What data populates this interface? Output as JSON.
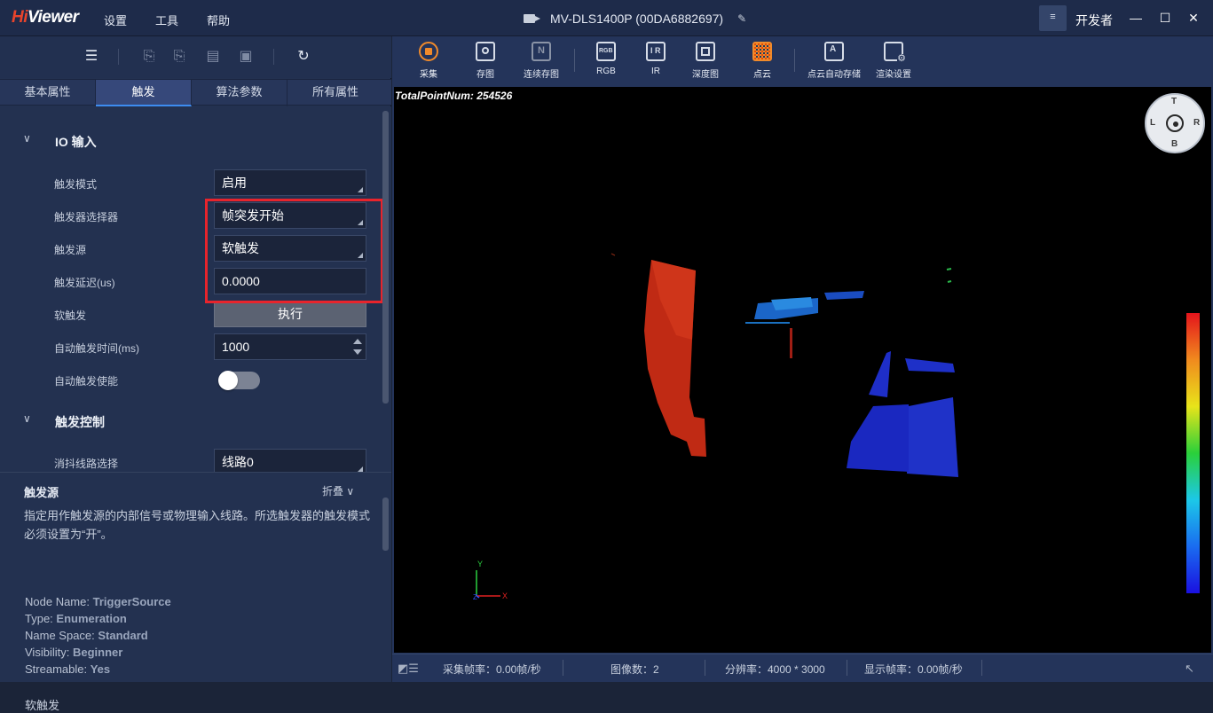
{
  "app": {
    "logo_hi": "Hi",
    "logo_rest": "Viewer",
    "menu": [
      "设置",
      "工具",
      "帮助"
    ],
    "device_title": "MV-DLS1400P (00DA6882697)",
    "user_role": "开发者",
    "user_menu_glyph": "≡"
  },
  "left_panel": {
    "tabs": [
      "基本属性",
      "触发",
      "算法参数",
      "所有属性"
    ],
    "active_tab": "触发",
    "groups": {
      "io_input": "IO 输入",
      "trigger_control": "触发控制"
    },
    "props": {
      "trigger_mode": {
        "label": "触发模式",
        "value": "启用"
      },
      "trigger_selector": {
        "label": "触发器选择器",
        "value": "帧突发开始"
      },
      "trigger_source": {
        "label": "触发源",
        "value": "软触发"
      },
      "trigger_delay": {
        "label": "触发延迟(us)",
        "value": "0.0000"
      },
      "software_trigger": {
        "label": "软触发",
        "button": "执行"
      },
      "auto_trigger_time": {
        "label": "自动触发时间(ms)",
        "value": "1000"
      },
      "auto_trigger_enable": {
        "label": "自动触发使能",
        "enabled": false
      },
      "debounce_line": {
        "label": "消抖线路选择",
        "value": "线路0"
      }
    },
    "description": {
      "title": "触发源",
      "fold_label": "折叠",
      "text": "指定用作触发源的内部信号或物理输入线路。所选触发器的触发模式必须设置为“开”。",
      "node_name_label": "Node Name:",
      "node_name": "TriggerSource",
      "type_label": "Type:",
      "type": "Enumeration",
      "name_space_label": "Name Space:",
      "name_space": "Standard",
      "visibility_label": "Visibility:",
      "visibility": "Beginner",
      "streamable_label": "Streamable:",
      "streamable": "Yes",
      "next_title": "软触发"
    }
  },
  "toolbar": {
    "capture": "采集",
    "save_image": "存图",
    "continuous_save": "连续存图",
    "rgb": "RGB",
    "ir": "IR",
    "depth": "深度图",
    "point_cloud": "点云",
    "pc_auto_save": "点云自动存储",
    "render_settings": "渲染设置"
  },
  "viewport": {
    "total_points": "TotalPointNum: 254526",
    "compass": {
      "top": "T",
      "left": "L",
      "right": "R",
      "bottom": "B"
    },
    "axis_y": "Y",
    "axis_x": "X",
    "axis_z": "Z",
    "colorbar_colors": [
      "#e4141c",
      "#f08a1e",
      "#e8e41a",
      "#2ad03a",
      "#1cc8e8",
      "#1a6cf0",
      "#1a10e0"
    ]
  },
  "statusbar": {
    "capture_fps": "采集帧率：0.00帧/秒",
    "image_count": "图像数：2",
    "resolution": "分辨率：4000 * 3000",
    "display_fps": "显示帧率：0.00帧/秒"
  }
}
